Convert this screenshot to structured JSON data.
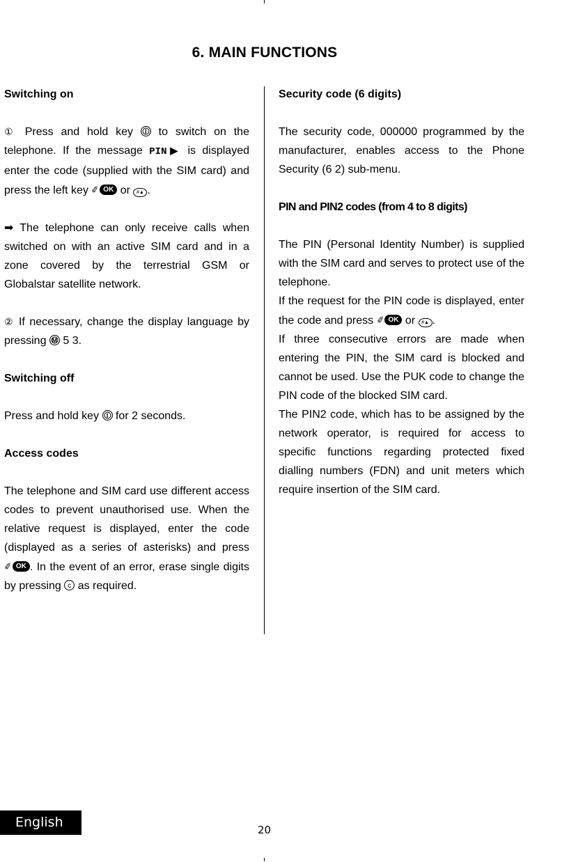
{
  "page": {
    "title": "6. MAIN FUNCTIONS",
    "language_tab": "English",
    "page_number": "20"
  },
  "left_column": {
    "switching_on": {
      "heading": "Switching on",
      "step1": {
        "marker": "①",
        "text_a": " Press and hold key ",
        "key_power": "I",
        "text_b": " to switch on the telephone. If the message ",
        "lcd_message": "PIN▶",
        "text_c": "    is di­splayed enter the code (supplied with the SIM card) and press the left key ",
        "key_ok": "OK",
        "text_d": " or ",
        "key_hash": "#▲",
        "text_e": "."
      },
      "note": {
        "marker": "➡",
        "text": " The telephone can only receive calls when switched on with an active SIM card and in a zone covered by the terrestrial GSM or Globalstar satellite network."
      },
      "step2": {
        "marker": "②",
        "text_a": " If necessary, change the display lan­guage by pressing ",
        "key_menu": "M",
        "text_b": " 5 3."
      }
    },
    "switching_off": {
      "heading": "Switching off",
      "text_a": "Press and hold key ",
      "key_power": "I",
      "text_b": " for 2 seconds."
    },
    "access_codes": {
      "heading": "Access codes",
      "text_a": "The telephone and SIM card use different access codes to prevent unauthorised use. When the relative request is di­splayed, enter the code (displayed as a series of asterisks) and press ",
      "key_ok": "OK",
      "text_b": ". In the event of an error, erase single digits by pressing ",
      "key_clear": "c",
      "text_c": " as required."
    }
  },
  "right_column": {
    "security_code": {
      "heading": "Security code (6 digits)",
      "text": "The security code, 000000 programmed by the manufacturer, enables  access to the Phone Security (6 2) sub-menu."
    },
    "pin_codes": {
      "heading": "PIN and PIN2 codes  (from 4 to 8 digits)",
      "para1": "The PIN (Personal Identity Number) is supplied with the SIM card and serves to protect use of the telephone.",
      "para2_a": "If the request for the PIN code is di­splayed, enter the code and press ",
      "key_ok": "OK",
      "para2_b": " or ",
      "key_hash": "#▲",
      "para2_c": ".",
      "para3": "If three consecutive errors are made when entering the PIN, the SIM card is blocked and cannot be used. Use the PUK code to change the PIN code of the blocked SIM card.",
      "para4": "The PIN2 code, which has to be assigned by the network operator, is required for access to specific functions regarding protected fixed dialling numbers (FDN) and unit meters  which require insertion of the SIM card."
    }
  }
}
